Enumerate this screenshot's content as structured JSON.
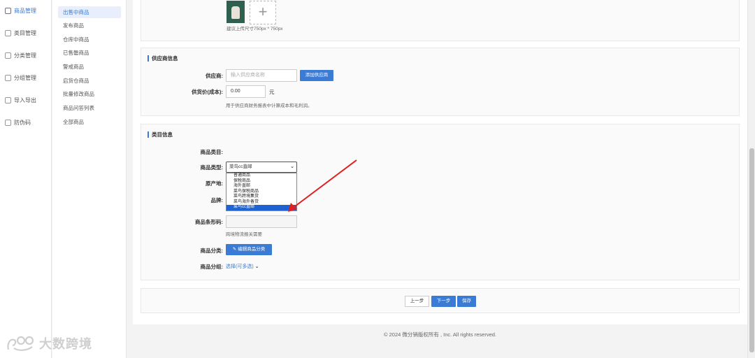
{
  "nav1": {
    "items": [
      {
        "label": "商品管理",
        "icon": "goods-icon"
      },
      {
        "label": "类目管理",
        "icon": "category-icon"
      },
      {
        "label": "分类管理",
        "icon": "classify-icon"
      },
      {
        "label": "分组管理",
        "icon": "group-icon"
      },
      {
        "label": "导入导出",
        "icon": "import-export-icon"
      },
      {
        "label": "防伪码",
        "icon": "anticounterfeit-icon"
      }
    ]
  },
  "nav2": {
    "items": [
      "出售中商品",
      "发布商品",
      "仓库中商品",
      "已售罄商品",
      "警戒商品",
      "启货仓商品",
      "批量修改商品",
      "商品问答列表",
      "全部商品"
    ]
  },
  "watermark": {
    "text": "大数跨境"
  },
  "image_section": {
    "hint": "建议上传尺寸750px * 750px"
  },
  "supplier": {
    "title": "供应商信息",
    "supplier_label": "供应商:",
    "supplier_placeholder": "输入供应商名称",
    "add_supplier": "添加供应商",
    "price_label": "供货价(成本):",
    "price_value": "0.00",
    "price_unit": "元",
    "price_hint": "用于供应商财务报表中计算成本和毛利润。"
  },
  "category": {
    "title": "类目信息",
    "category_label": "商品类目:",
    "type_label": "商品类型:",
    "type_value": "菜鸟cc直邮",
    "origin_label": "原产地:",
    "brand_label": "品牌:",
    "barcode_label": "商品条形码:",
    "barcode_hint": "跨境物流报关需要",
    "classify_label": "商品分类:",
    "classify_button": "编辑商品分类",
    "group_label": "商品分组:",
    "group_link": "选择(可多选)",
    "type_options": [
      "普通商品",
      "保税商品",
      "海外直邮",
      "菜鸟保税商品",
      "菜鸟跨境集货",
      "菜鸟海外备货",
      "菜鸟cc直邮"
    ],
    "type_selected_index": 6
  },
  "actions": {
    "prev": "上一步",
    "next": "下一步",
    "save": "保存"
  },
  "footer": {
    "text": "© 2024 微分销版权所有 , Inc. All rights reserved."
  },
  "colors": {
    "accent": "#3a7bd5",
    "annotation_arrow": "#e02020"
  }
}
